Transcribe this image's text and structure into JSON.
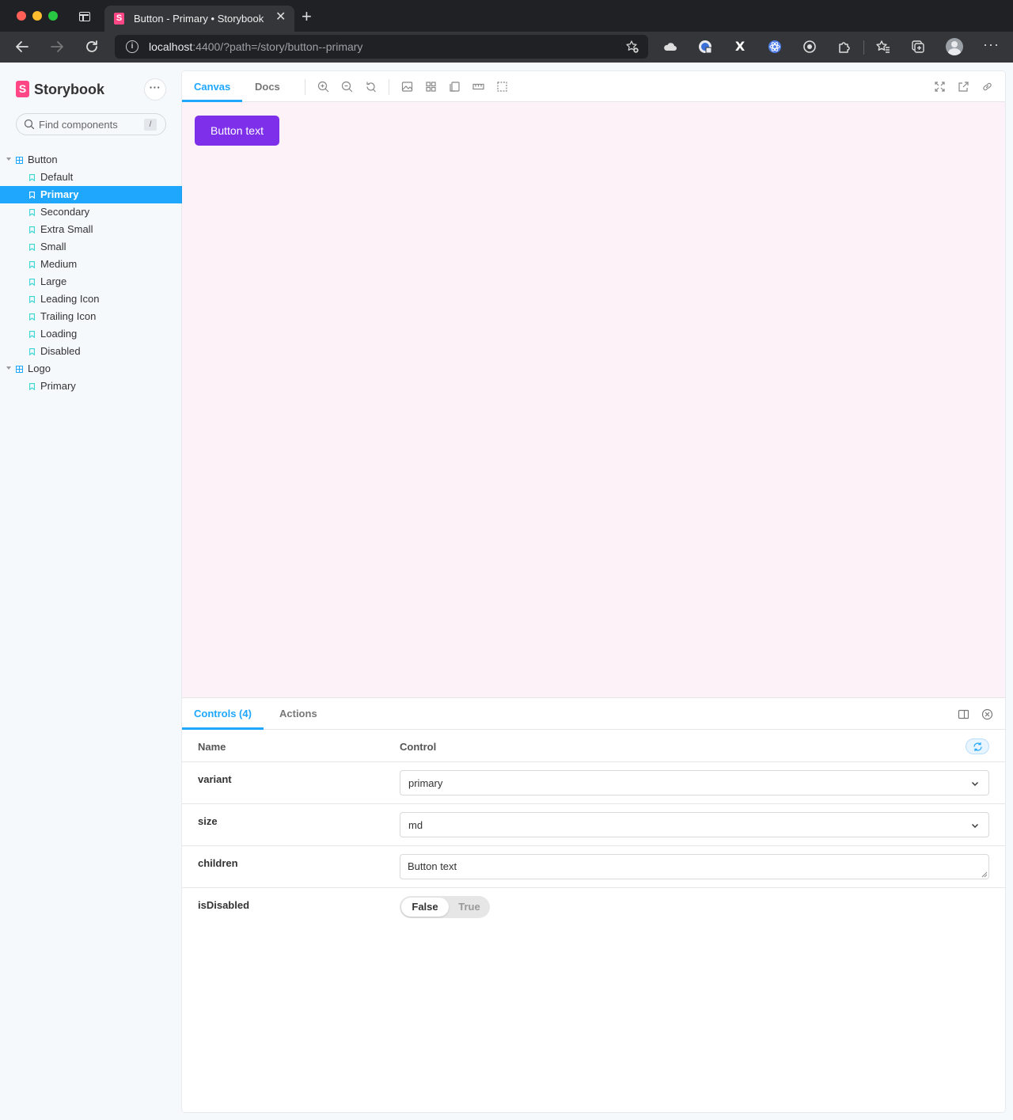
{
  "browser": {
    "tab_title": "Button - Primary • Storybook",
    "favicon_letter": "S",
    "url_host": "localhost",
    "url_rest": ":4400/?path=/story/button--primary",
    "info_glyph": "i",
    "new_tab_glyph": "+",
    "close_glyph": "✕",
    "more_glyph": "···",
    "ext_x_label": "X"
  },
  "sidebar": {
    "logo_letter": "S",
    "logo_text": "Storybook",
    "menu_glyph": "···",
    "search_placeholder": "Find components",
    "search_shortcut": "/",
    "tree": [
      {
        "label": "Button",
        "children": [
          "Default",
          "Primary",
          "Secondary",
          "Extra Small",
          "Small",
          "Medium",
          "Large",
          "Leading Icon",
          "Trailing Icon",
          "Loading",
          "Disabled"
        ]
      },
      {
        "label": "Logo",
        "children": [
          "Primary"
        ]
      }
    ],
    "selected": "Primary"
  },
  "toolbar": {
    "tabs": [
      "Canvas",
      "Docs"
    ],
    "active_tab": "Canvas"
  },
  "canvas": {
    "background": "#fdf2f8",
    "button_label": "Button text",
    "button_color": "#7e2fea"
  },
  "addons": {
    "tabs": [
      "Controls (4)",
      "Actions"
    ],
    "active_tab": "Controls (4)",
    "header_name": "Name",
    "header_control": "Control",
    "controls": {
      "variant": {
        "name": "variant",
        "value": "primary"
      },
      "size": {
        "name": "size",
        "value": "md"
      },
      "children": {
        "name": "children",
        "value": "Button text"
      },
      "isDisabled": {
        "name": "isDisabled",
        "false_label": "False",
        "true_label": "True",
        "value": false
      }
    }
  },
  "colors": {
    "accent": "#1ea7fd",
    "brand": "#ff4785"
  }
}
